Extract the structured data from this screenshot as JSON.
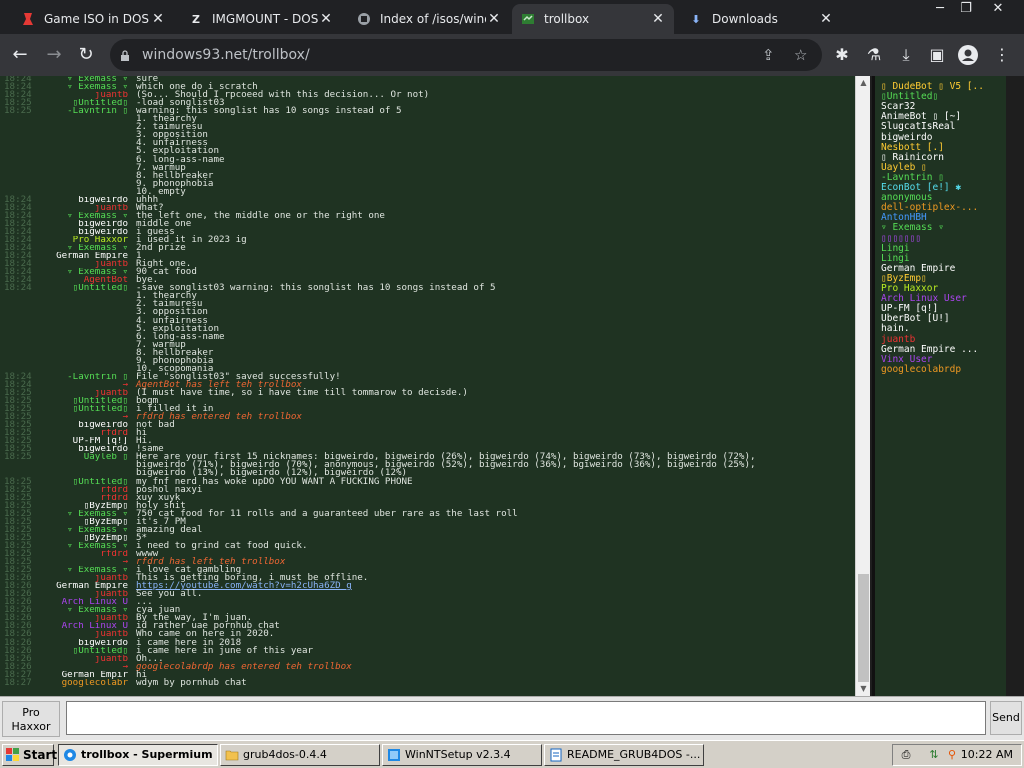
{
  "browser": {
    "tabs": [
      {
        "title": "Game ISO in DOSBo",
        "icon": "dosbox-icon",
        "active": false
      },
      {
        "title": "IMGMOUNT - DOSB",
        "icon": "z-icon",
        "active": false
      },
      {
        "title": "Index of /isos/windo",
        "icon": "archive-icon",
        "active": false
      },
      {
        "title": "trollbox",
        "icon": "trollbox-icon",
        "active": true
      },
      {
        "title": "Downloads",
        "icon": "download-icon",
        "active": false
      }
    ],
    "url": "windows93.net/trollbox/"
  },
  "chat": {
    "messages": [
      {
        "time": "18:24",
        "nick": "▿ Exemass ▿",
        "nick_color": "#55dd55",
        "text": "sure"
      },
      {
        "time": "18:24",
        "nick": "▿ Exemass ▿",
        "nick_color": "#55dd55",
        "text": "which one do i scratch"
      },
      {
        "time": "18:24",
        "nick": "juantb",
        "nick_color": "#ee3333",
        "text": "(So... Should I rpcoeed with this decision... Or not)"
      },
      {
        "time": "18:25",
        "nick": "▯Untitled▯",
        "nick_color": "#55dd55",
        "text": "-load songlist03"
      },
      {
        "time": "18:25",
        "nick": "-Lavntrin ▯",
        "nick_color": "#55dd55",
        "text": "warning: this songlist has 10 songs instead of 5"
      },
      {
        "time": "",
        "nick": "",
        "nick_color": "#55dd55",
        "text": "1. thearchy"
      },
      {
        "time": "",
        "nick": "",
        "nick_color": "#55dd55",
        "text": "2. taimuresu"
      },
      {
        "time": "",
        "nick": "",
        "nick_color": "#55dd55",
        "text": "3. opposition"
      },
      {
        "time": "",
        "nick": "",
        "nick_color": "#55dd55",
        "text": "4. unfairness"
      },
      {
        "time": "",
        "nick": "",
        "nick_color": "#55dd55",
        "text": "5. exploitation"
      },
      {
        "time": "",
        "nick": "",
        "nick_color": "#55dd55",
        "text": "6. long-ass-name"
      },
      {
        "time": "",
        "nick": "",
        "nick_color": "#55dd55",
        "text": "7. warmup"
      },
      {
        "time": "",
        "nick": "",
        "nick_color": "#55dd55",
        "text": "8. hellbreaker"
      },
      {
        "time": "",
        "nick": "",
        "nick_color": "#55dd55",
        "text": "9. phonophobia"
      },
      {
        "time": "",
        "nick": "",
        "nick_color": "#55dd55",
        "text": "10. empty"
      },
      {
        "time": "18:24",
        "nick": "bigweirdo",
        "nick_color": "#ffffff",
        "text": "uhhh"
      },
      {
        "time": "18:24",
        "nick": "juantb",
        "nick_color": "#ee3333",
        "text": "What?"
      },
      {
        "time": "18:24",
        "nick": "▿ Exemass ▿",
        "nick_color": "#55dd55",
        "text": "the left one, the middle one or the right one"
      },
      {
        "time": "18:24",
        "nick": "bigweirdo",
        "nick_color": "#ffffff",
        "text": "middle one"
      },
      {
        "time": "18:24",
        "nick": "bigweirdo",
        "nick_color": "#ffffff",
        "text": "i guess"
      },
      {
        "time": "18:24",
        "nick": "Pro Haxxor",
        "nick_color": "#bbee22",
        "text": "i used it in 2023 ig"
      },
      {
        "time": "18:24",
        "nick": "▿ Exemass ▿",
        "nick_color": "#55dd55",
        "text": "2nd prize"
      },
      {
        "time": "18:24",
        "nick": "German Empire",
        "nick_color": "#ffffff",
        "text": "1"
      },
      {
        "time": "18:24",
        "nick": "juantb",
        "nick_color": "#ee3333",
        "text": "Right one."
      },
      {
        "time": "18:24",
        "nick": "▿ Exemass ▿",
        "nick_color": "#55dd55",
        "text": "90 cat food"
      },
      {
        "time": "18:24",
        "nick": "AgentBot",
        "nick_color": "#ee3333",
        "text": "bye."
      },
      {
        "time": "18:24",
        "nick": "▯Untitled▯",
        "nick_color": "#55dd55",
        "text": "-save songlist03 warning: this songlist has 10 songs instead of 5"
      },
      {
        "time": "",
        "nick": "",
        "nick_color": "#55dd55",
        "text": "1. thearchy"
      },
      {
        "time": "",
        "nick": "",
        "nick_color": "#55dd55",
        "text": "2. taimuresu"
      },
      {
        "time": "",
        "nick": "",
        "nick_color": "#55dd55",
        "text": "3. opposition"
      },
      {
        "time": "",
        "nick": "",
        "nick_color": "#55dd55",
        "text": "4. unfairness"
      },
      {
        "time": "",
        "nick": "",
        "nick_color": "#55dd55",
        "text": "5. exploitation"
      },
      {
        "time": "",
        "nick": "",
        "nick_color": "#55dd55",
        "text": "6. long-ass-name"
      },
      {
        "time": "",
        "nick": "",
        "nick_color": "#55dd55",
        "text": "7. warmup"
      },
      {
        "time": "",
        "nick": "",
        "nick_color": "#55dd55",
        "text": "8. hellbreaker"
      },
      {
        "time": "",
        "nick": "",
        "nick_color": "#55dd55",
        "text": "9. phonophobia"
      },
      {
        "time": "",
        "nick": "",
        "nick_color": "#55dd55",
        "text": "10. scopomania"
      },
      {
        "time": "18:24",
        "nick": "-Lavntrin ▯",
        "nick_color": "#55dd55",
        "text": "File \"songlist03\" saved successfully!"
      },
      {
        "time": "18:24",
        "nick": "→",
        "nick_color": "#ee3333",
        "text": "AgentBot has left teh trollbox",
        "system": true,
        "text_color": "#ee6633"
      },
      {
        "time": "18:25",
        "nick": "juantb",
        "nick_color": "#ee3333",
        "text": "(I must have time, so i have time till tommarow to decisde.)"
      },
      {
        "time": "18:25",
        "nick": "▯Untitled▯",
        "nick_color": "#55dd55",
        "text": "bogm"
      },
      {
        "time": "18:25",
        "nick": "▯Untitled▯",
        "nick_color": "#55dd55",
        "text": "i filled it in"
      },
      {
        "time": "18:25",
        "nick": "→",
        "nick_color": "#ee3333",
        "text": "rfdrd has entered teh trollbox",
        "system": true,
        "text_color": "#ee6633"
      },
      {
        "time": "18:25",
        "nick": "bigweirdo",
        "nick_color": "#ffffff",
        "text": "not bad"
      },
      {
        "time": "18:25",
        "nick": "rfdrd",
        "nick_color": "#ee3333",
        "text": "hi"
      },
      {
        "time": "18:25",
        "nick": "UP-FM [q!]",
        "nick_color": "#ffffff",
        "text": "Hi."
      },
      {
        "time": "18:25",
        "nick": "bigweirdo",
        "nick_color": "#ffffff",
        "text": "!same"
      },
      {
        "time": "18:25",
        "nick": "Uayleb ▯",
        "nick_color": "#55dd55",
        "text": "Here are your first 15 nicknames: bigweirdo, bigweirdo (26%), bigweirdo (74%), bigweirdo (73%), bigweirdo (72%),"
      },
      {
        "time": "",
        "nick": "",
        "nick_color": "#55dd55",
        "text": "bigweirdo (71%), bigweirdo (70%), anonymous, bigweirdo (52%), bigweirdo (36%), bgiweirdo (36%), bigweirdo (25%),"
      },
      {
        "time": "",
        "nick": "",
        "nick_color": "#55dd55",
        "text": "bigweirdo (13%), bigweirdo (12%), bigweirdo (12%)"
      },
      {
        "time": "18:25",
        "nick": "▯Untitled▯",
        "nick_color": "#55dd55",
        "text": "my fnf nerd has woke upDO YOU WANT A FUCKING PHONE"
      },
      {
        "time": "18:25",
        "nick": "rfdrd",
        "nick_color": "#ee3333",
        "text": "poshol naxyi"
      },
      {
        "time": "18:25",
        "nick": "rfdrd",
        "nick_color": "#ee3333",
        "text": "xuy xuyk"
      },
      {
        "time": "18:25",
        "nick": "▯ByzEmp▯",
        "nick_color": "#ffffff",
        "text": "holy shit"
      },
      {
        "time": "18:25",
        "nick": "▿ Exemass ▿",
        "nick_color": "#55dd55",
        "text": "750 cat food for 11 rolls and a guaranteed uber rare as the last roll"
      },
      {
        "time": "18:25",
        "nick": "▯ByzEmp▯",
        "nick_color": "#ffffff",
        "text": "it's 7 PM"
      },
      {
        "time": "18:25",
        "nick": "▿ Exemass ▿",
        "nick_color": "#55dd55",
        "text": "amazing deal"
      },
      {
        "time": "18:25",
        "nick": "▯ByzEmp▯",
        "nick_color": "#ffffff",
        "text": "5*"
      },
      {
        "time": "18:25",
        "nick": "▿ Exemass ▿",
        "nick_color": "#55dd55",
        "text": "i need to grind cat food quick."
      },
      {
        "time": "18:25",
        "nick": "rfdrd",
        "nick_color": "#ee3333",
        "text": "wwww"
      },
      {
        "time": "18:25",
        "nick": "→",
        "nick_color": "#ee3333",
        "text": "rfdrd has left teh trollbox",
        "system": true,
        "text_color": "#ee6633"
      },
      {
        "time": "18:25",
        "nick": "▿ Exemass ▿",
        "nick_color": "#55dd55",
        "text": "i love cat gambling"
      },
      {
        "time": "18:26",
        "nick": "juantb",
        "nick_color": "#ee3333",
        "text": "This is getting boring, i must be offline."
      },
      {
        "time": "18:26",
        "nick": "German Empire",
        "nick_color": "#ffffff",
        "text": "https://youtube.com/watch?v=h2cUha6ZD_g",
        "link": true
      },
      {
        "time": "18:26",
        "nick": "juantb",
        "nick_color": "#ee3333",
        "text": "See you all."
      },
      {
        "time": "18:26",
        "nick": "Arch Linux U",
        "nick_color": "#aa44ee",
        "text": "..."
      },
      {
        "time": "18:26",
        "nick": "▿ Exemass ▿",
        "nick_color": "#55dd55",
        "text": "cya juan"
      },
      {
        "time": "18:26",
        "nick": "juantb",
        "nick_color": "#ee3333",
        "text": "By the way, I'm juan."
      },
      {
        "time": "18:26",
        "nick": "Arch Linux U",
        "nick_color": "#aa44ee",
        "text": "id rather uae pornhub chat"
      },
      {
        "time": "18:26",
        "nick": "juantb",
        "nick_color": "#ee3333",
        "text": "Who came on here in 2020."
      },
      {
        "time": "18:26",
        "nick": "bigweirdo",
        "nick_color": "#ffffff",
        "text": "i came here in 2018"
      },
      {
        "time": "18:26",
        "nick": "▯Untitled▯",
        "nick_color": "#55dd55",
        "text": "i came here in june of this year"
      },
      {
        "time": "18:26",
        "nick": "juantb",
        "nick_color": "#ee3333",
        "text": "Oh..."
      },
      {
        "time": "18:26",
        "nick": "→",
        "nick_color": "#ee3333",
        "text": "googlecolabrdp has entered teh trollbox",
        "system": true,
        "text_color": "#ee6633"
      },
      {
        "time": "18:27",
        "nick": "German Empir",
        "nick_color": "#ffffff",
        "text": "hi"
      },
      {
        "time": "18:27",
        "nick": "googlecolabr",
        "nick_color": "#ee9922",
        "text": "wdym by pornhub chat"
      }
    ]
  },
  "users": [
    {
      "name": "▯ DudeBot ▯ V5 [..",
      "color": "#ffcc33"
    },
    {
      "name": "▯Untitled▯",
      "color": "#55dd55"
    },
    {
      "name": "Scar32",
      "color": "#ffffff"
    },
    {
      "name": "AnimeBot ▯ [~]",
      "color": "#ffffff"
    },
    {
      "name": "SlugcatIsReal",
      "color": "#ffffff"
    },
    {
      "name": "bigweirdo",
      "color": "#ffffff"
    },
    {
      "name": "Nesbott [.]",
      "color": "#ffcc33"
    },
    {
      "name": "▯ Rainicorn",
      "color": "#ffffff"
    },
    {
      "name": "Uayleb ▯",
      "color": "#ffcc33"
    },
    {
      "name": "-Lavntrin ▯",
      "color": "#55dd55"
    },
    {
      "name": "EconBot [e!] ✱",
      "color": "#55ddee"
    },
    {
      "name": "anonymous",
      "color": "#55dd55"
    },
    {
      "name": "dell-optiplex-...",
      "color": "#ee9922"
    },
    {
      "name": "AntonHBH",
      "color": "#4499ff"
    },
    {
      "name": "▿ Exemass ▿",
      "color": "#55dd55"
    },
    {
      "name": "▯▯▯▯▯▯▯",
      "color": "#aa44ee"
    },
    {
      "name": "Lingi",
      "color": "#55dd55"
    },
    {
      "name": "Lingi",
      "color": "#55dd55"
    },
    {
      "name": "German Empire",
      "color": "#ffffff"
    },
    {
      "name": "▯ByzEmp▯",
      "color": "#ffcc33"
    },
    {
      "name": "Pro Haxxor",
      "color": "#bbee22"
    },
    {
      "name": "Arch Linux User",
      "color": "#aa44ee"
    },
    {
      "name": "UP-FM [q!]",
      "color": "#ffffff"
    },
    {
      "name": "UberBot [U!]",
      "color": "#ffffff"
    },
    {
      "name": "hain.",
      "color": "#ffffff"
    },
    {
      "name": "juantb",
      "color": "#ee3333"
    },
    {
      "name": "German Empire ...",
      "color": "#ffffff"
    },
    {
      "name": "Vinx User",
      "color": "#aa44ee"
    },
    {
      "name": "googlecolabrdp",
      "color": "#ee9922"
    }
  ],
  "composer": {
    "author_name": "Pro Haxxor",
    "input_value": "",
    "send_label": "Send"
  },
  "taskbar": {
    "start_label": "Start",
    "tasks": [
      {
        "label": "trollbox - Supermium",
        "active": true
      },
      {
        "label": "grub4dos-0.4.4",
        "active": false
      },
      {
        "label": "WinNTSetup v2.3.4",
        "active": false
      },
      {
        "label": "README_GRUB4DOS -...",
        "active": false
      }
    ],
    "clock": "10:22 AM"
  }
}
